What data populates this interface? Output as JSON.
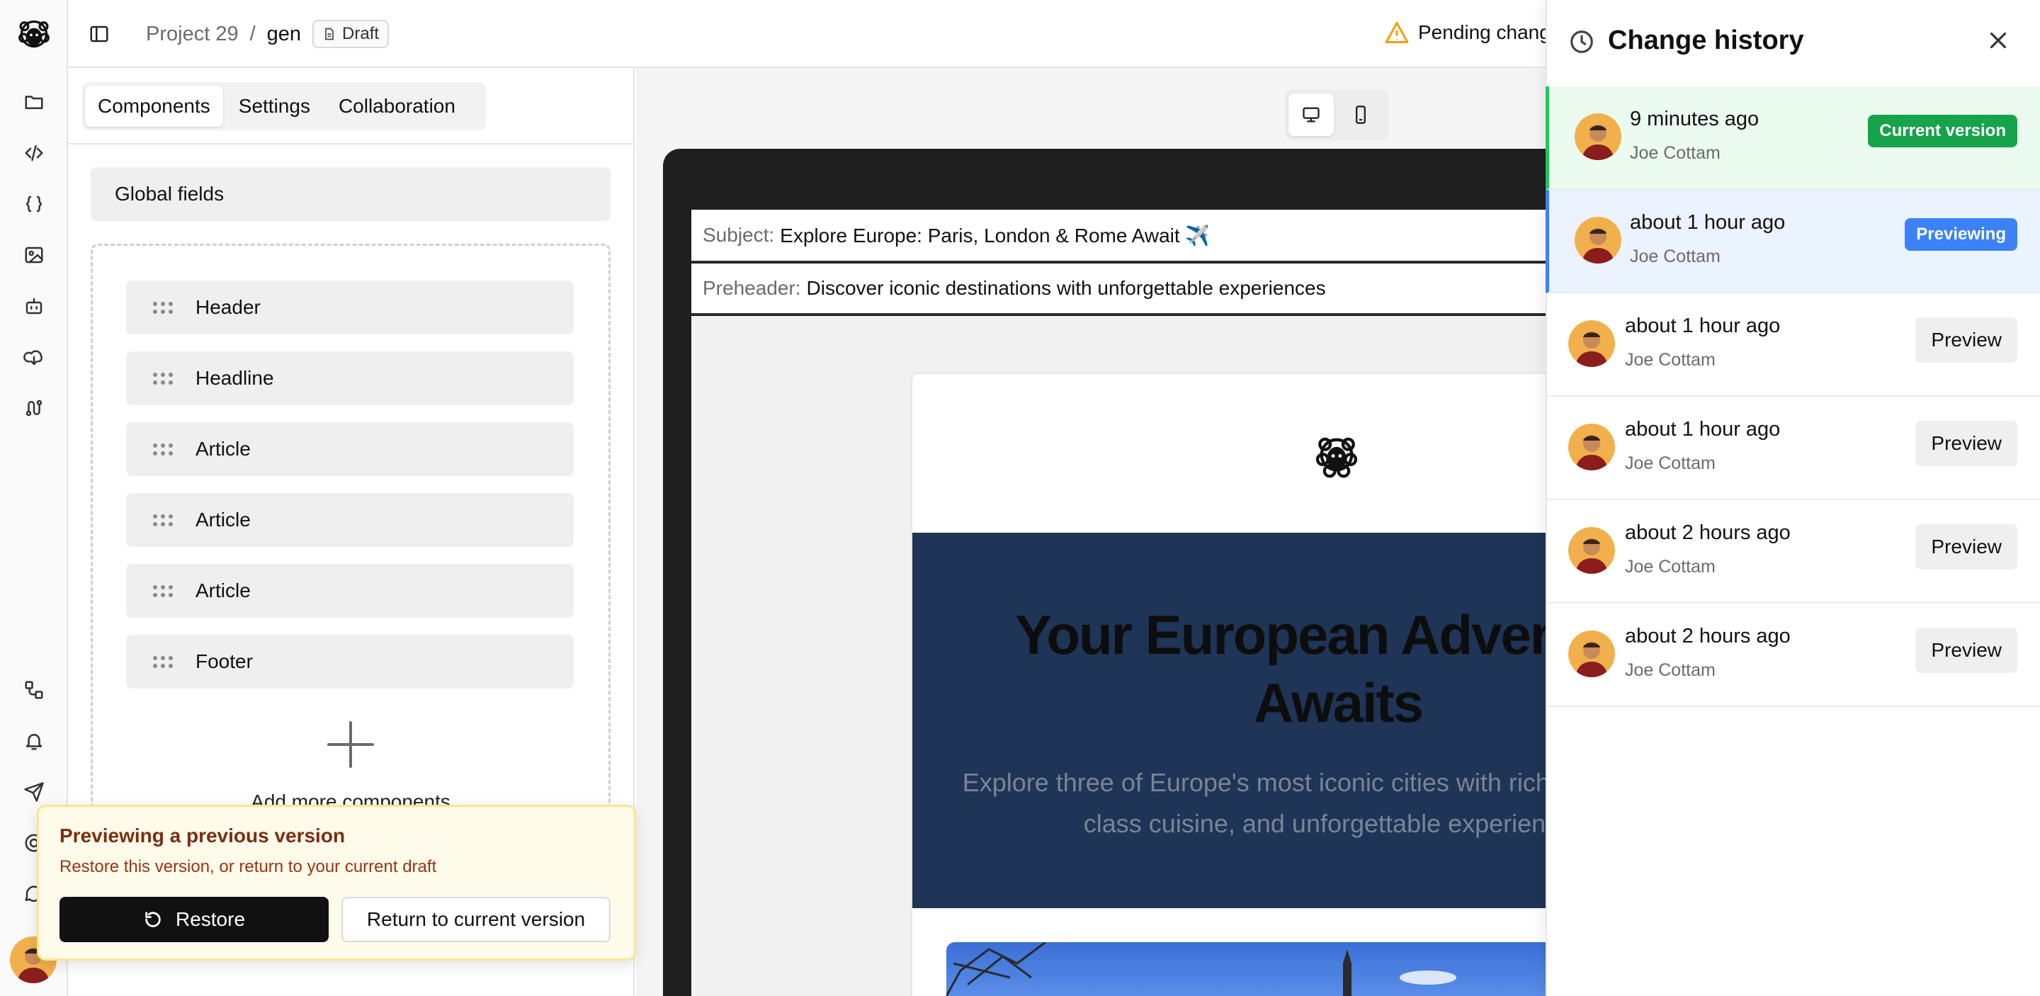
{
  "breadcrumb": {
    "project": "Project 29",
    "separator": "/",
    "item": "gen",
    "status_badge": "Draft"
  },
  "topbar": {
    "pending_text": "Pending changes"
  },
  "left_panel": {
    "tabs": [
      {
        "label": "Components",
        "active": true
      },
      {
        "label": "Settings",
        "active": false
      },
      {
        "label": "Collaboration",
        "active": false
      }
    ],
    "global_fields_label": "Global fields",
    "components": [
      "Header",
      "Headline",
      "Article",
      "Article",
      "Article",
      "Footer"
    ],
    "add_more_label": "Add more components"
  },
  "preview_banner": {
    "title": "Previewing a previous version",
    "subtitle": "Restore this version, or return to your current draft",
    "restore_label": "Restore",
    "return_label": "Return to current version"
  },
  "preview": {
    "device_modes": [
      "desktop",
      "mobile"
    ],
    "active_device": "desktop",
    "subject_key": "Subject:",
    "subject_value": "Explore Europe: Paris, London & Rome Await ✈️",
    "preheader_key": "Preheader:",
    "preheader_value": "Discover iconic destinations with unforgettable experiences",
    "hero_title": "Your European Adventure Awaits",
    "hero_description": "Explore three of Europe's most iconic cities with rich history, world-class cuisine, and unforgettable experiences."
  },
  "history": {
    "title": "Change history",
    "entries": [
      {
        "time": "9 minutes ago",
        "author": "Joe Cottam",
        "badge": "Current version"
      },
      {
        "time": "about 1 hour ago",
        "author": "Joe Cottam",
        "badge": "Previewing"
      },
      {
        "time": "about 1 hour ago",
        "author": "Joe Cottam",
        "button": "Preview"
      },
      {
        "time": "about 1 hour ago",
        "author": "Joe Cottam",
        "button": "Preview"
      },
      {
        "time": "about 2 hours ago",
        "author": "Joe Cottam",
        "button": "Preview"
      },
      {
        "time": "about 2 hours ago",
        "author": "Joe Cottam",
        "button": "Preview"
      }
    ]
  },
  "colors": {
    "current_badge": "#16a34a",
    "previewing_badge": "#3b82f6",
    "hero_background": "#1e3557",
    "warning": "#f59e0b",
    "banner_background": "#fffbea"
  },
  "icons": [
    "sheep-logo-icon",
    "folder-icon",
    "code-icon",
    "braces-icon",
    "image-icon",
    "bot-icon",
    "download-cloud-icon",
    "route-icon",
    "workflow-icon",
    "bell-icon",
    "send-icon",
    "help-icon",
    "message-icon",
    "sidebar-toggle-icon",
    "file-icon",
    "warning-icon",
    "clock-icon",
    "close-icon",
    "desktop-icon",
    "mobile-icon",
    "restore-icon",
    "plus-icon"
  ]
}
